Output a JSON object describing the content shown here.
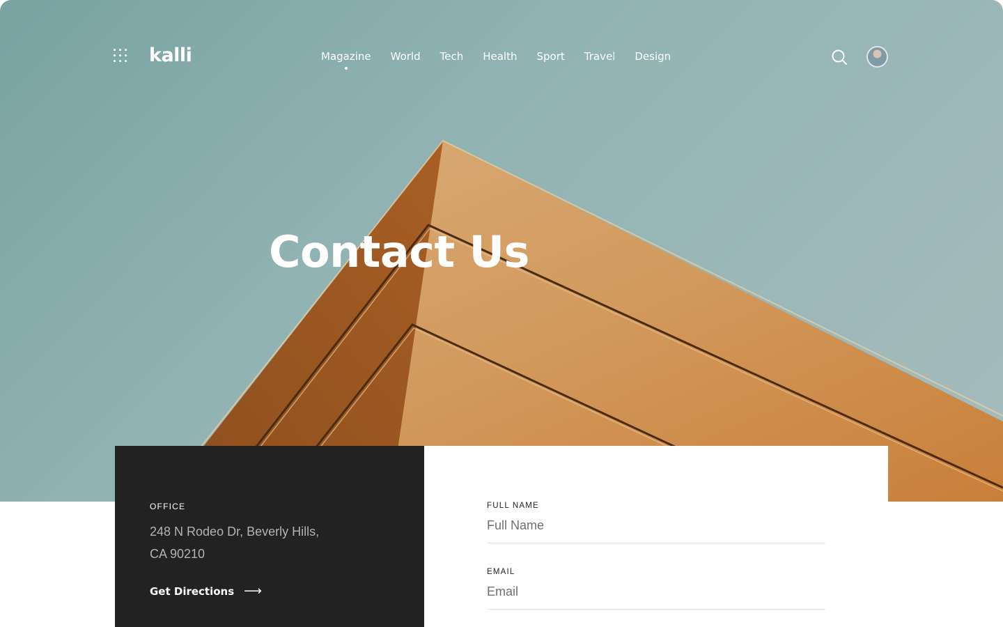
{
  "header": {
    "logo": "kalli",
    "nav": [
      "Magazine",
      "World",
      "Tech",
      "Health",
      "Sport",
      "Travel",
      "Design"
    ],
    "active_nav": "Magazine",
    "menu_icon": "grid-menu-icon",
    "search_icon": "search-icon",
    "avatar_icon": "avatar"
  },
  "hero": {
    "title": "Contact Us"
  },
  "office": {
    "label": "OFFICE",
    "address_line1": "248 N Rodeo Dr, Beverly Hills,",
    "address_line2": "CA 90210",
    "directions_label": "Get Directions",
    "directions_icon": "arrow-right-icon"
  },
  "form": {
    "full_name": {
      "label": "FULL NAME",
      "placeholder": "Full Name",
      "value": ""
    },
    "email": {
      "label": "EMAIL",
      "placeholder": "Email",
      "value": ""
    }
  },
  "colors": {
    "sky": "#8fb1b0",
    "building_light": "#d4a46e",
    "building_dark": "#a35a22",
    "panel_dark": "#222222",
    "text_white": "#ffffff"
  }
}
